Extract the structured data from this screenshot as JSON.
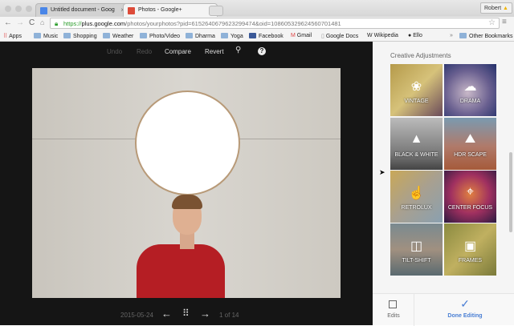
{
  "browser": {
    "tabs": [
      {
        "title": "Untitled document - Goog",
        "active": false
      },
      {
        "title": "Photos - Google+",
        "active": true
      }
    ],
    "profile": "Robert",
    "url_scheme": "https://",
    "url_host": "plus.google.com",
    "url_path": "/photos/yourphotos?pid=6152640679623299474&oid=108605329624560701481",
    "bookmarks": [
      "Apps",
      "Music",
      "Shopping",
      "Weather",
      "Photo/Video",
      "Dharma",
      "Yoga",
      "Facebook",
      "Gmail",
      "Google Docs",
      "Wikipedia",
      "Ello"
    ],
    "other_bookmarks": "Other Bookmarks",
    "overflow": "»"
  },
  "editor": {
    "undo": "Undo",
    "redo": "Redo",
    "compare": "Compare",
    "revert": "Revert",
    "date": "2015-05-24",
    "counter": "1 of 14"
  },
  "panel": {
    "section_title": "Creative Adjustments",
    "tiles": [
      {
        "label": "VINTAGE",
        "icon": "flower-icon"
      },
      {
        "label": "DRAMA",
        "icon": "cloud-bolt-icon"
      },
      {
        "label": "BLACK & WHITE",
        "icon": "eiffel-icon"
      },
      {
        "label": "HDR SCAPE",
        "icon": "mountains-icon"
      },
      {
        "label": "RETROLUX",
        "icon": "hand-icon"
      },
      {
        "label": "CENTER FOCUS",
        "icon": "focus-icon"
      },
      {
        "label": "TILT-SHIFT",
        "icon": "tilt-shift-icon"
      },
      {
        "label": "FRAMES",
        "icon": "frame-icon"
      }
    ],
    "edits": "Edits",
    "done": "Done Editing",
    "accent": "#4a7fd4"
  }
}
